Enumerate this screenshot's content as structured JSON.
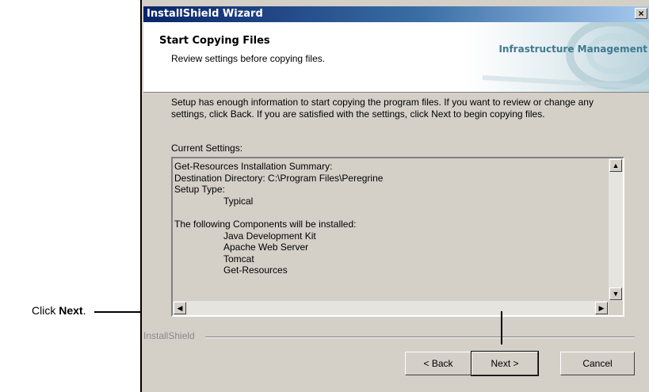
{
  "window": {
    "title": "InstallShield Wizard",
    "close_glyph": "×"
  },
  "header": {
    "title": "Start Copying Files",
    "subtitle": "Review settings before copying files.",
    "brand": "Infrastructure Management"
  },
  "body": {
    "description": "Setup has enough information to start copying the program files.  If you want to review or change any settings, click Back.  If you are satisfied with the settings, click Next to begin copying files.",
    "settings_label": "Current Settings:"
  },
  "settings_list": {
    "lines": [
      "Get-Resources Installation Summary:",
      "Destination Directory: C:\\Program Files\\Peregrine",
      "Setup Type:"
    ],
    "setup_type": "Typical",
    "components_header": "The following Components will be installed:",
    "components": [
      "Java Development Kit",
      "Apache Web Server",
      "Tomcat",
      "Get-Resources"
    ]
  },
  "footer": {
    "installshield": "InstallShield"
  },
  "buttons": {
    "back": "< Back",
    "next": "Next >",
    "cancel": "Cancel"
  },
  "callout": {
    "prefix": "Click ",
    "emphasis": "Next",
    "suffix": "."
  },
  "colors": {
    "titlebar": "#0a246a",
    "brand": "#3e7a92",
    "face": "#d4d0c8"
  }
}
